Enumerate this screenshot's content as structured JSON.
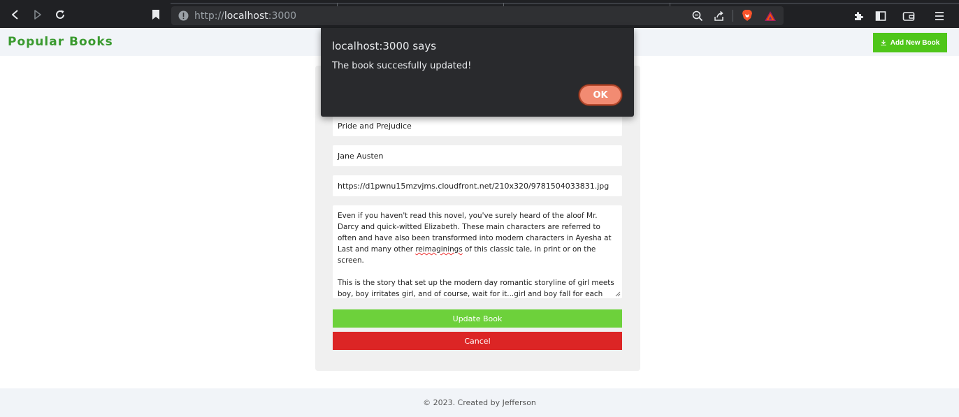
{
  "browser": {
    "url_prefix": "http://",
    "url_host": "localhost",
    "url_port": ":3000"
  },
  "header": {
    "brand": "Popular Books",
    "add_button_label": "Add New Book"
  },
  "form": {
    "title_value": "Pride and Prejudice",
    "author_value": "Jane Austen",
    "image_value": "https://d1pwnu15mzvjms.cloudfront.net/210x320/9781504033831.jpg",
    "description_part1": "Even if you haven't read this novel, you've surely heard of the aloof Mr. Darcy and quick-witted Elizabeth. These main characters are referred to often and have also been transformed into modern characters in Ayesha at Last and many other ",
    "description_spell_word": "reimaginings",
    "description_part2": " of this classic tale, in print or on the screen.\n\nThis is the story that set up the modern day romantic storyline of girl meets boy, boy irritates girl, and of course, wait for it...girl and boy fall for each other.",
    "update_label": "Update Book",
    "cancel_label": "Cancel"
  },
  "footer": {
    "text": "© 2023. Created by Jefferson"
  },
  "dialog": {
    "title": "localhost:3000 says",
    "message": "The book succesfully updated!",
    "ok_label": "OK"
  },
  "colors": {
    "brand": "#3a9a2f",
    "add_button": "#4fc61a",
    "update_button": "#6dd13b",
    "cancel_button": "#dc2525",
    "dialog_ok": "#f28b72"
  }
}
